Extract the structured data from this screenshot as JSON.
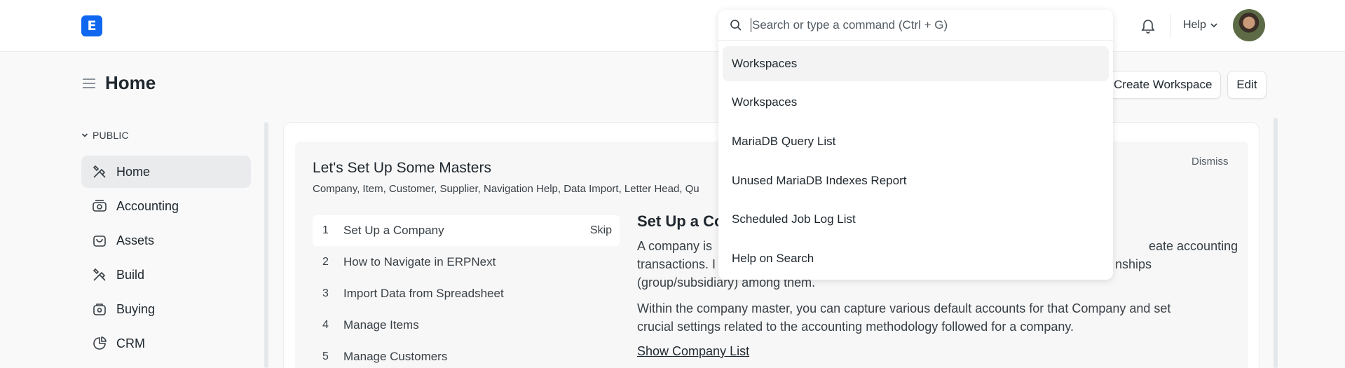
{
  "navbar": {
    "logo_letter": "E",
    "help_label": "Help"
  },
  "page": {
    "title": "Home",
    "create_workspace_label": "Create Workspace",
    "edit_label": "Edit"
  },
  "sidebar": {
    "section_label": "PUBLIC",
    "items": [
      {
        "label": "Home",
        "icon": "home-tools-icon"
      },
      {
        "label": "Accounting",
        "icon": "accounting-icon"
      },
      {
        "label": "Assets",
        "icon": "assets-icon"
      },
      {
        "label": "Build",
        "icon": "build-icon"
      },
      {
        "label": "Buying",
        "icon": "buying-icon"
      },
      {
        "label": "CRM",
        "icon": "crm-icon"
      }
    ]
  },
  "onboarding": {
    "title": "Let's Set Up Some Masters",
    "subtitle": "Company, Item, Customer, Supplier, Navigation Help, Data Import, Letter Head, Qu",
    "dismiss_label": "Dismiss",
    "steps": [
      {
        "num": "1",
        "label": "Set Up a Company",
        "skip": "Skip"
      },
      {
        "num": "2",
        "label": "How to Navigate in ERPNext"
      },
      {
        "num": "3",
        "label": "Import Data from Spreadsheet"
      },
      {
        "num": "4",
        "label": "Manage Items"
      },
      {
        "num": "5",
        "label": "Manage Customers"
      }
    ],
    "detail": {
      "title": "Set Up a Co",
      "p1_line1": "A company is",
      "p1_line1_tail": "eate accounting",
      "p1_line2": "transactions. I",
      "p1_line2_tail": "nships",
      "p1_line3": "(group/subsidiary) among them.",
      "p2_line1": "Within the company master, you can capture various default accounts for that Company and set",
      "p2_line2": "crucial settings related to the accounting methodology followed for a company.",
      "link": "Show Company List"
    }
  },
  "search": {
    "placeholder": "Search or type a command (Ctrl + G)",
    "results": [
      "Workspaces",
      "Workspaces",
      "MariaDB Query List",
      "Unused MariaDB Indexes Report",
      "Scheduled Job Log List",
      "Help on Search"
    ]
  },
  "colors": {
    "brand": "#0f67f0",
    "active_bg": "#e9ebed"
  }
}
